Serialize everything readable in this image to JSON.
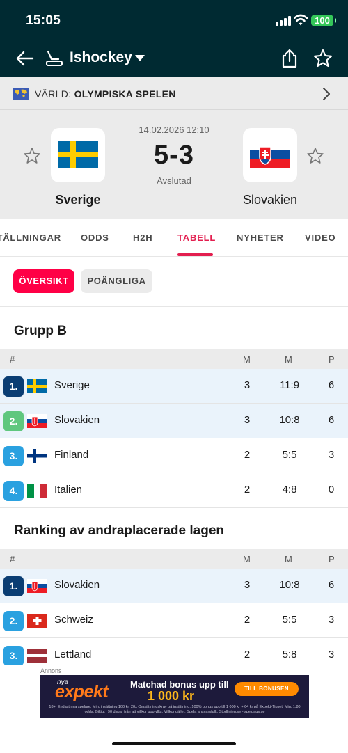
{
  "status_bar": {
    "time": "15:05",
    "battery": "100"
  },
  "app_bar": {
    "title": "Ishockey"
  },
  "league": {
    "country": "VÄRLD:",
    "name": "OLYMPISKA SPELEN"
  },
  "match": {
    "datetime": "14.02.2026 12:10",
    "score": "5-3",
    "status": "Avslutad",
    "home": {
      "name": "Sverige"
    },
    "away": {
      "name": "Slovakien"
    }
  },
  "tabs": [
    "STÄLLNINGAR",
    "ODDS",
    "H2H",
    "TABELL",
    "NYHETER",
    "VIDEO"
  ],
  "pills": {
    "overview": "ÖVERSIKT",
    "points": "POÄNGLIGA"
  },
  "group": {
    "title": "Grupp B",
    "headers": {
      "rank": "#",
      "played": "M",
      "goals": "M",
      "points": "P"
    },
    "rows": [
      {
        "rank": "1.",
        "team": "Sverige",
        "played": "3",
        "goals": "11:9",
        "points": "6",
        "rank_color": "#0a3d73",
        "flag": "sweden"
      },
      {
        "rank": "2.",
        "team": "Slovakien",
        "played": "3",
        "goals": "10:8",
        "points": "6",
        "rank_color": "#5fc77e",
        "flag": "slovakia"
      },
      {
        "rank": "3.",
        "team": "Finland",
        "played": "2",
        "goals": "5:5",
        "points": "3",
        "rank_color": "#2aa1e0",
        "flag": "finland"
      },
      {
        "rank": "4.",
        "team": "Italien",
        "played": "2",
        "goals": "4:8",
        "points": "0",
        "rank_color": "#2aa1e0",
        "flag": "italy"
      }
    ]
  },
  "ranking": {
    "title": "Ranking av andraplacerade lagen",
    "headers": {
      "rank": "#",
      "played": "M",
      "goals": "M",
      "points": "P"
    },
    "rows": [
      {
        "rank": "1.",
        "team": "Slovakien",
        "played": "3",
        "goals": "10:8",
        "points": "6",
        "rank_color": "#0a3d73",
        "flag": "slovakia"
      },
      {
        "rank": "2.",
        "team": "Schweiz",
        "played": "2",
        "goals": "5:5",
        "points": "3",
        "rank_color": "#2aa1e0",
        "flag": "switzerland"
      },
      {
        "rank": "3.",
        "team": "Lettland",
        "played": "2",
        "goals": "5:8",
        "points": "3",
        "rank_color": "#2aa1e0",
        "flag": "latvia"
      }
    ]
  },
  "ad": {
    "label": "Annons",
    "nya": "nya",
    "brand": "expekt",
    "headline": "Matchad bonus upp till",
    "amount": "1 000 kr",
    "cta": "TILL BONUSEN",
    "fine_print": "18+. Endast nya spelare. Min. insättning 100 kr. 20x Omsättningskrav på insättning. 100% bonus upp till 1 000 kr + 64 kr på Expekt-Tipset. Min. 1,80 odds. Giltigt i 90 dagar från att villkor uppfyllts. Villkor gäller. Spela ansvarsfullt. Stodlinjen.se - spelpaus.se"
  },
  "colors": {
    "brand_dark": "#002a32",
    "accent": "#ff0046",
    "tab_active": "#e31e4f"
  }
}
